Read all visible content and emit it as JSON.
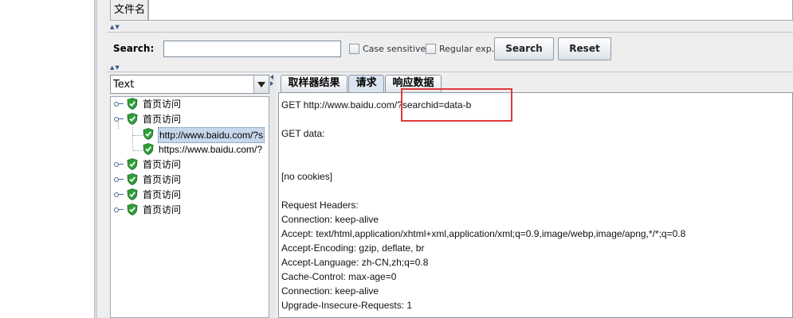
{
  "file_panel": {
    "label": "文件名",
    "value": ""
  },
  "search": {
    "label": "Search:",
    "value": "",
    "case_sensitive_label": "Case sensitive",
    "regex_label": "Regular exp.",
    "search_button": "Search",
    "reset_button": "Reset"
  },
  "view_selector": {
    "selected": "Text"
  },
  "tree": {
    "nodes": [
      {
        "label": "首页访问",
        "expanded": false,
        "status": "success"
      },
      {
        "label": "首页访问",
        "expanded": true,
        "status": "success",
        "children": [
          {
            "label": "http://www.baidu.com/?s",
            "selected": true,
            "status": "success"
          },
          {
            "label": "https://www.baidu.com/?",
            "selected": false,
            "status": "success"
          }
        ]
      },
      {
        "label": "首页访问",
        "expanded": false,
        "status": "success"
      },
      {
        "label": "首页访问",
        "expanded": false,
        "status": "success"
      },
      {
        "label": "首页访问",
        "expanded": false,
        "status": "success"
      },
      {
        "label": "首页访问",
        "expanded": false,
        "status": "success"
      }
    ]
  },
  "tabs": [
    {
      "label": "取样器结果",
      "active": false
    },
    {
      "label": "请求",
      "active": true
    },
    {
      "label": "响应数据",
      "active": false
    }
  ],
  "request": {
    "request_line": "GET http://www.baidu.com/?searchid=data-b",
    "get_data": "GET data:",
    "cookies": "[no cookies]",
    "headers_title": "Request Headers:",
    "headers": [
      "Connection: keep-alive",
      "Accept: text/html,application/xhtml+xml,application/xml;q=0.9,image/webp,image/apng,*/*;q=0.8",
      "Accept-Encoding: gzip, deflate, br",
      "Accept-Language: zh-CN,zh;q=0.8",
      "Cache-Control: max-age=0",
      "Connection: keep-alive",
      "Upgrade-Insecure-Requests: 1"
    ]
  },
  "colors": {
    "highlight": "#e03a3a",
    "success": "#2e9e3a",
    "selection": "#c8d8ec"
  }
}
